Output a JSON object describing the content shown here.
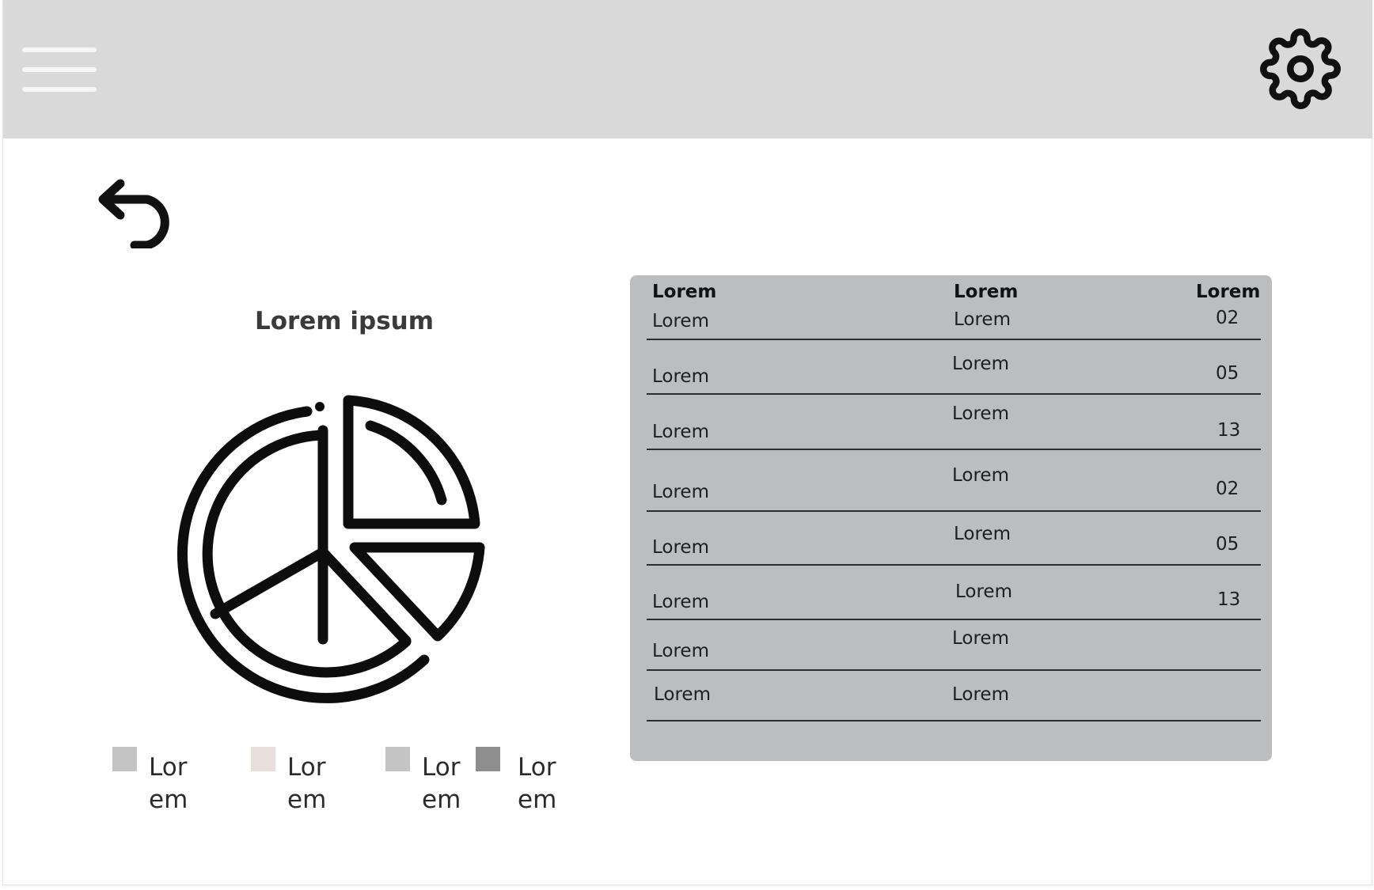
{
  "header": {
    "menu_icon": "hamburger-menu-icon",
    "settings_icon": "gear-icon"
  },
  "nav": {
    "back_icon": "undo-arrow-icon"
  },
  "chart": {
    "title": "Lorem ipsum",
    "icon": "pie-chart-icon"
  },
  "legend": [
    {
      "label": "Lorem",
      "color": "#c4c4c4"
    },
    {
      "label": "Lorem",
      "color": "#e8dedc"
    },
    {
      "label": "Lorem",
      "color": "#c4c4c4"
    },
    {
      "label": "Lorem",
      "color": "#8e8e8e"
    }
  ],
  "table": {
    "headers": [
      "Lorem",
      "Lorem",
      "Lorem"
    ],
    "rows": [
      [
        "Lorem",
        "Lorem",
        "02"
      ],
      [
        "Lorem",
        "Lorem",
        "05"
      ],
      [
        "Lorem",
        "Lorem",
        "13"
      ],
      [
        "Lorem",
        "Lorem",
        "02"
      ],
      [
        "Lorem",
        "Lorem",
        "05"
      ],
      [
        "Lorem",
        "Lorem",
        "13"
      ],
      [
        "Lorem",
        "Lorem",
        ""
      ],
      [
        "Lorem",
        "Lorem",
        ""
      ]
    ]
  },
  "colors": {
    "header_bg": "#d9d9d9",
    "table_bg": "#bcbdbf",
    "icon_color": "#111111"
  }
}
